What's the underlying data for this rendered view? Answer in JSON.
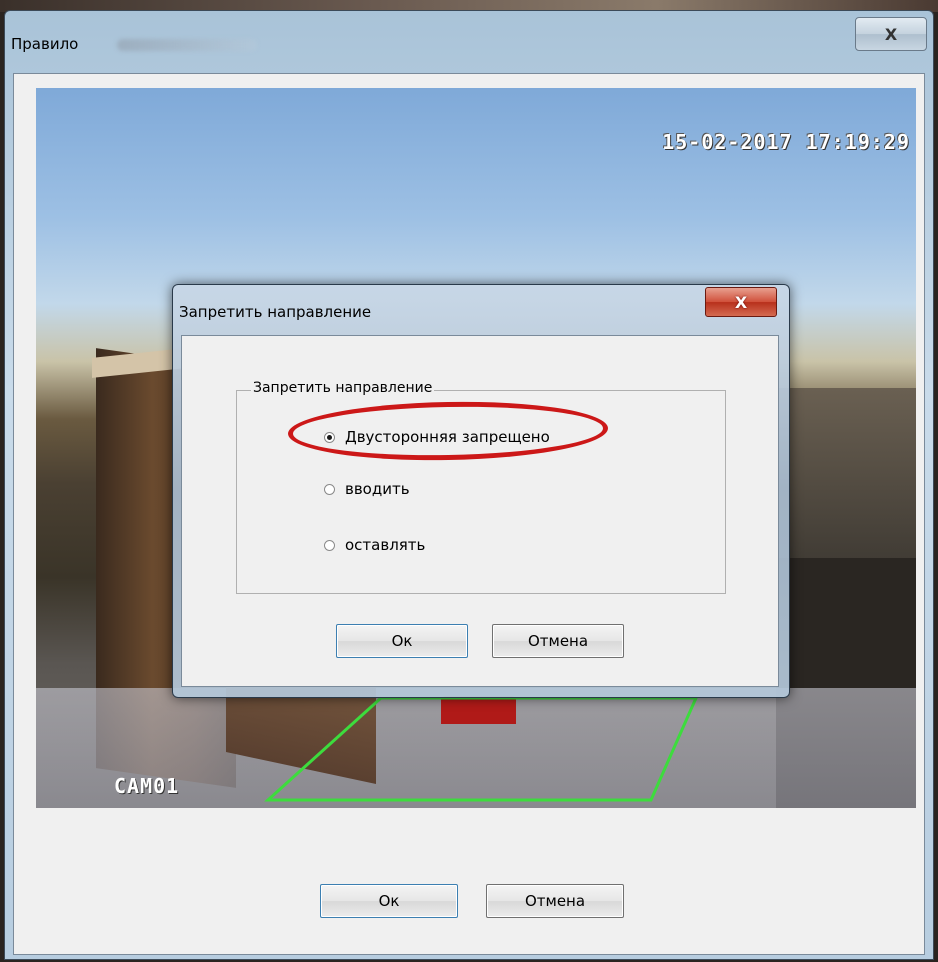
{
  "outer_window": {
    "title": "Правило",
    "close_label": "X",
    "ok_label": "Ок",
    "cancel_label": "Отмена"
  },
  "video": {
    "timestamp": "15-02-2017 17:19:29",
    "camera_label": "CAM01"
  },
  "inner_dialog": {
    "title": "Запретить направление",
    "close_label": "X",
    "group_label": "Запретить направление",
    "options": [
      {
        "label": "Двусторонняя запрещено",
        "selected": true
      },
      {
        "label": "вводить",
        "selected": false
      },
      {
        "label": "оставлять",
        "selected": false
      }
    ],
    "ok_label": "Ок",
    "cancel_label": "Отмена"
  },
  "colors": {
    "highlight": "#cc1818",
    "zone_line": "#3ddc3d"
  }
}
